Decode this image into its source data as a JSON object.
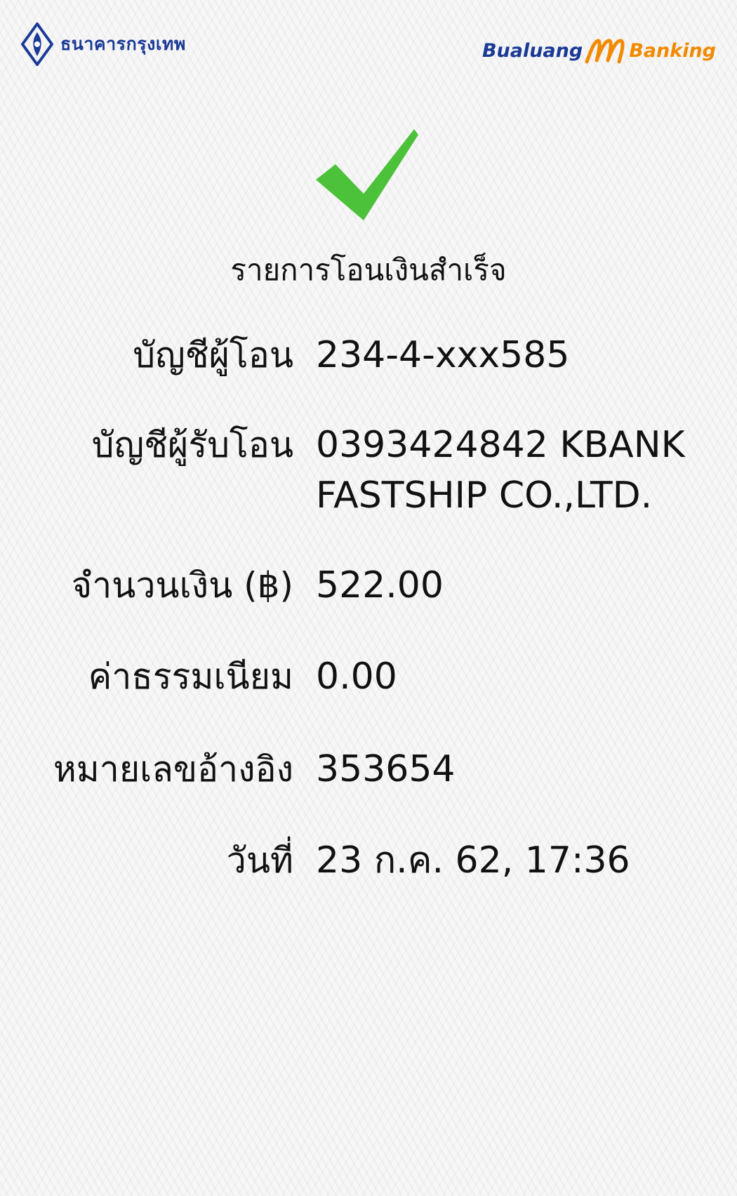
{
  "header": {
    "bank_name": "ธนาคารกรุงเทพ",
    "app_brand_left": "Bualuang",
    "app_brand_right": "Banking"
  },
  "status": {
    "icon": "check-icon",
    "title": "รายการโอนเงินสำเร็จ",
    "color": "#4cc23a"
  },
  "details": {
    "from_account_label": "บัญชีผู้โอน",
    "from_account_value": "234-4-xxx585",
    "to_account_label": "บัญชีผู้รับโอน",
    "to_account_value_line1": "0393424842 KBANK",
    "to_account_value_line2": "FASTSHIP CO.,LTD.",
    "amount_label": "จำนวนเงิน (฿)",
    "amount_value": "522.00",
    "fee_label": "ค่าธรรมเนียม",
    "fee_value": "0.00",
    "reference_label": "หมายเลขอ้างอิง",
    "reference_value": "353654",
    "date_label": "วันที่",
    "date_value": "23 ก.ค. 62, 17:36"
  },
  "colors": {
    "brand_blue": "#1a3a96",
    "brand_orange": "#f28a00"
  }
}
